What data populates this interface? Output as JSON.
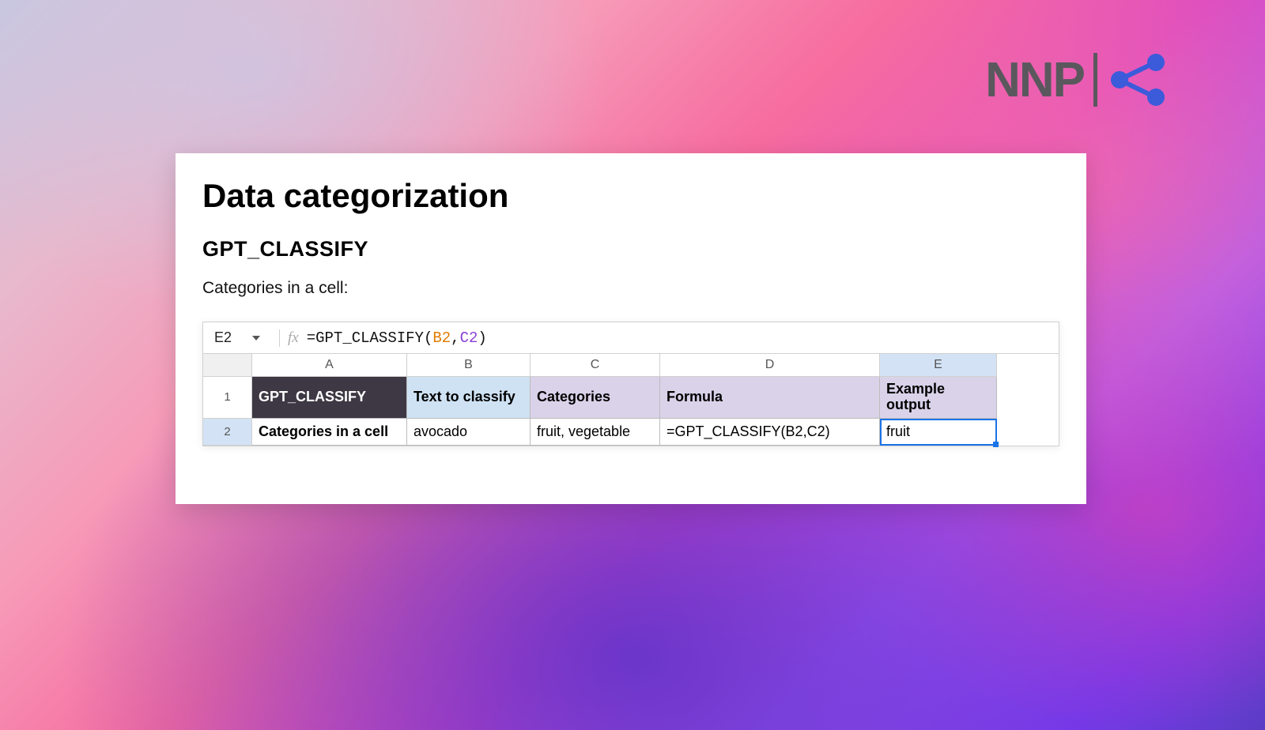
{
  "logo": {
    "text": "NNP"
  },
  "card": {
    "title": "Data categorization",
    "subtitle": "GPT_CLASSIFY",
    "description": "Categories in a cell:"
  },
  "formula_bar": {
    "namebox": "E2",
    "fx_label": "fx",
    "prefix": "=GPT_CLASSIFY(",
    "ref1": "B2",
    "comma": ",",
    "ref2": "C2",
    "suffix": ")"
  },
  "columns": [
    "A",
    "B",
    "C",
    "D",
    "E"
  ],
  "rows": [
    "1",
    "2"
  ],
  "headers": {
    "a": "GPT_CLASSIFY",
    "b": "Text to classify",
    "c": "Categories",
    "d": "Formula",
    "e": "Example output"
  },
  "data_row": {
    "a": "Categories in a cell",
    "b": "avocado",
    "c": "fruit, vegetable",
    "d": "=GPT_CLASSIFY(B2,C2)",
    "e": "fruit"
  },
  "selected_cell": "E2"
}
